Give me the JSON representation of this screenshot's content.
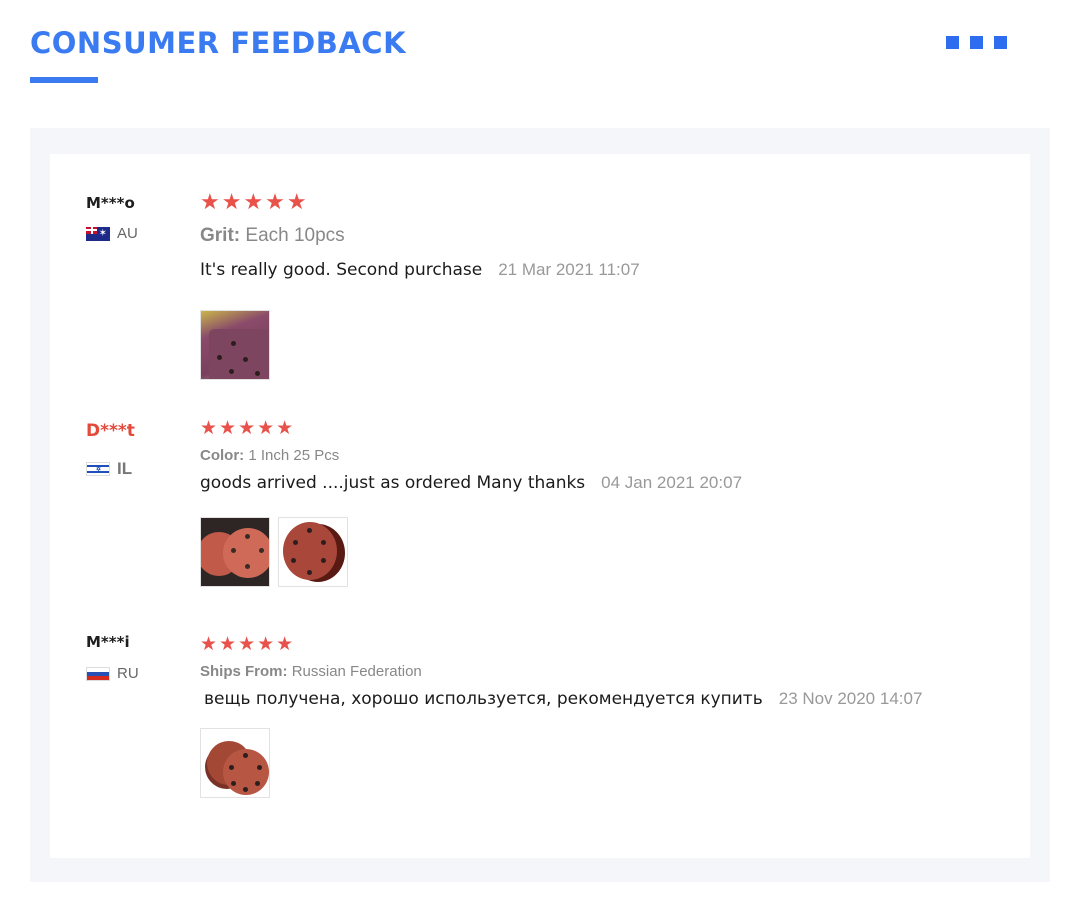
{
  "header": {
    "title": "CONSUMER FEEDBACK"
  },
  "reviews": [
    {
      "name": "M***o",
      "country": "AU",
      "stars": "★★★★★",
      "sku_key": "Grit:",
      "sku_value": "Each 10pcs",
      "text": "It's really good. Second purchase",
      "date": "21 Mar 2021 11:07",
      "rating": 5
    },
    {
      "name": "D***t",
      "country": "IL",
      "stars": "★★★★★",
      "sku_key": "Color:",
      "sku_value": "1 Inch 25 Pcs",
      "text": "goods arrived ....just as ordered Many thanks",
      "date": "04 Jan 2021 20:07",
      "rating": 5
    },
    {
      "name": "M***i",
      "country": "RU",
      "stars": "★★★★★",
      "sku_key": "Ships From:",
      "sku_value": "Russian Federation",
      "text": "вещь получена, хорошо используется, рекомендуется купить",
      "date": "23 Nov 2020 14:07",
      "rating": 5
    }
  ],
  "colors": {
    "accent": "#3a7bf2",
    "star": "#e8524a",
    "highlight_name": "#e44a3a"
  }
}
